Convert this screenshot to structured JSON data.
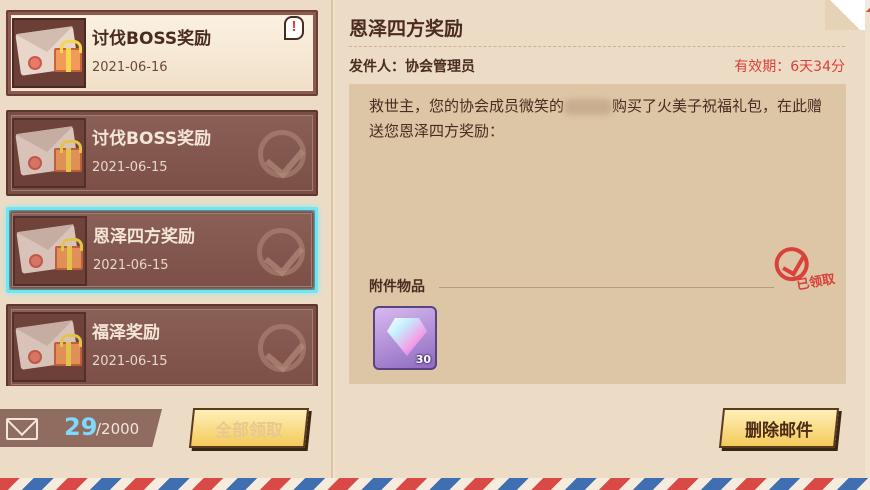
{
  "mail_list": {
    "items": [
      {
        "title": "讨伐BOSS奖励",
        "date": "2021-06-16",
        "state": "unread"
      },
      {
        "title": "讨伐BOSS奖励",
        "date": "2021-06-15",
        "state": "read"
      },
      {
        "title": "恩泽四方奖励",
        "date": "2021-06-15",
        "state": "selected"
      },
      {
        "title": "福泽奖励",
        "date": "2021-06-15",
        "state": "read"
      }
    ],
    "alert_glyph": "!"
  },
  "footer": {
    "count_current": "29",
    "count_total": "/2000",
    "claim_all_label": "全部领取",
    "delete_label": "删除邮件"
  },
  "detail": {
    "subject": "恩泽四方奖励",
    "sender": "发件人：协会管理员",
    "expiry": "有效期：6天34分",
    "body_before": "救世主，您的协会成员微笑的",
    "body_after": "购买了火美子祝福礼包，在此赠送您恩泽四方奖励：",
    "attachments_label": "附件物品",
    "claimed_stamp": "已领取",
    "attachment": {
      "icon": "diamond-gem-icon",
      "quantity": "30"
    }
  },
  "colors": {
    "accent_selected": "#6fe6f2",
    "expiry_red": "#d9413b",
    "count_blue": "#7fd9ff",
    "button_gold": "#f4c95a"
  }
}
